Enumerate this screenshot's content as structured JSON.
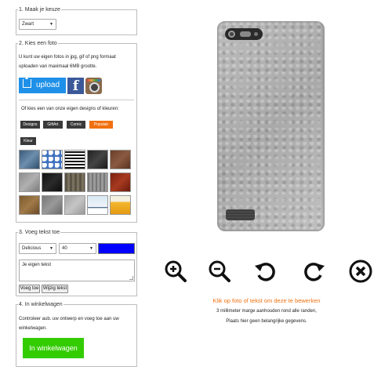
{
  "step1": {
    "legend": "1. Maak je keuze",
    "color_select": "Zwart"
  },
  "step2": {
    "legend": "2. Kies een foto",
    "instruction": "U kunt uw eigen fotos in jpg, gif of png formaat uploaden van maximaal 6MB grootte.",
    "upload_label": "upload",
    "facebook_glyph": "f",
    "or_text": "Of kies een van onze eigen designs of kleuren:",
    "categories": [
      {
        "label": "Designs",
        "active": false
      },
      {
        "label": "GiftArt",
        "active": false
      },
      {
        "label": "Comic",
        "active": false
      },
      {
        "label": "Populair",
        "active": true
      },
      {
        "label": "Kleur",
        "active": false
      }
    ],
    "swatch_names": [
      "denim-texture",
      "blue-floral-pattern",
      "black-white-stripes",
      "dark-texture",
      "brown-leather",
      "grey-concrete",
      "black-leather",
      "wood-bark",
      "grey-wood",
      "red-leather",
      "rust-texture",
      "grey-stone",
      "grey-leather",
      "snow-landscape",
      "beer-foam"
    ]
  },
  "step3": {
    "legend": "3. Voeg tekst toe",
    "font_select": "Delicious",
    "size_select": "40",
    "text_color": "#0000ff",
    "textarea_value": "Je eigen tekst",
    "add_button": "Voeg toe",
    "edit_button": "Wijzig tekst"
  },
  "step4": {
    "legend": "4. In winkelwagen",
    "instruction": "Controleer aub. uw ontwerp en voeg toe aan uw winkelwagen.",
    "cart_button": "In winkelwagen"
  },
  "toolbar": {
    "icons": [
      "zoom-in-icon",
      "zoom-out-icon",
      "rotate-left-icon",
      "rotate-right-icon",
      "delete-icon"
    ]
  },
  "info": {
    "click_hint": "Klik op foto of tekst om deze te bewerken",
    "margin_note": "3 millimeter marge aanhouden rond alle randen,",
    "placement_note": "Plaats hier geen belangrijke gegevens."
  },
  "colors": {
    "accent_orange": "#f07010",
    "upload_blue": "#1e90e8",
    "cart_green": "#33cc00",
    "facebook_blue": "#3b5998"
  }
}
